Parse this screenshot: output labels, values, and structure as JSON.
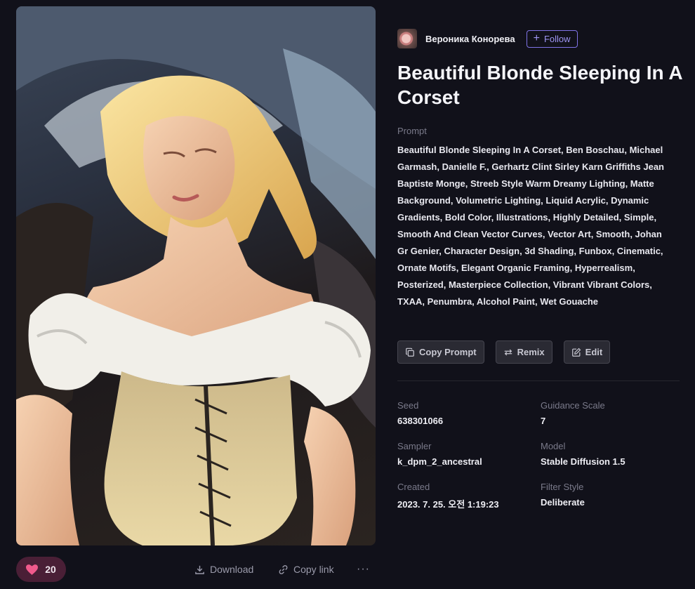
{
  "artwork": {
    "alt": "Beautiful Blonde Sleeping In A Corset"
  },
  "author": {
    "name": "Вероника Конорева",
    "follow_label": "Follow"
  },
  "title": "Beautiful Blonde Sleeping In A Corset",
  "prompt": {
    "label": "Prompt",
    "text": "Beautiful Blonde Sleeping In A Corset, Ben Boschau, Michael Garmash, Danielle F., Gerhartz Clint Sirley Karn Griffiths Jean Baptiste Monge, Streeb Style Warm Dreamy Lighting, Matte Background, Volumetric Lighting, Liquid Acrylic, Dynamic Gradients, Bold Color, Illustrations, Highly Detailed, Simple, Smooth And Clean Vector Curves, Vector Art, Smooth, Johan Gr Genier, Character Design, 3d Shading, Funbox, Cinematic, Ornate Motifs, Elegant Organic Framing, Hyperrealism, Posterized, Masterpiece Collection, Vibrant Vibrant Colors, TXAA, Penumbra, Alcohol Paint, Wet Gouache"
  },
  "actions": {
    "copy_prompt": "Copy Prompt",
    "remix": "Remix",
    "edit": "Edit"
  },
  "details": {
    "seed": {
      "label": "Seed",
      "value": "638301066"
    },
    "guidance_scale": {
      "label": "Guidance Scale",
      "value": "7"
    },
    "sampler": {
      "label": "Sampler",
      "value": "k_dpm_2_ancestral"
    },
    "model": {
      "label": "Model",
      "value": "Stable Diffusion 1.5"
    },
    "created": {
      "label": "Created",
      "value": "2023. 7. 25. 오전 1:19:23"
    },
    "filter_style": {
      "label": "Filter Style",
      "value": "Deliberate"
    }
  },
  "bottom_bar": {
    "like_count": "20",
    "download_label": "Download",
    "copy_link_label": "Copy link",
    "more_label": "···"
  },
  "colors": {
    "background": "#11111a",
    "accent": "#7f73e6",
    "like_bg": "#4a1f36",
    "heart": "#f05a8c"
  }
}
